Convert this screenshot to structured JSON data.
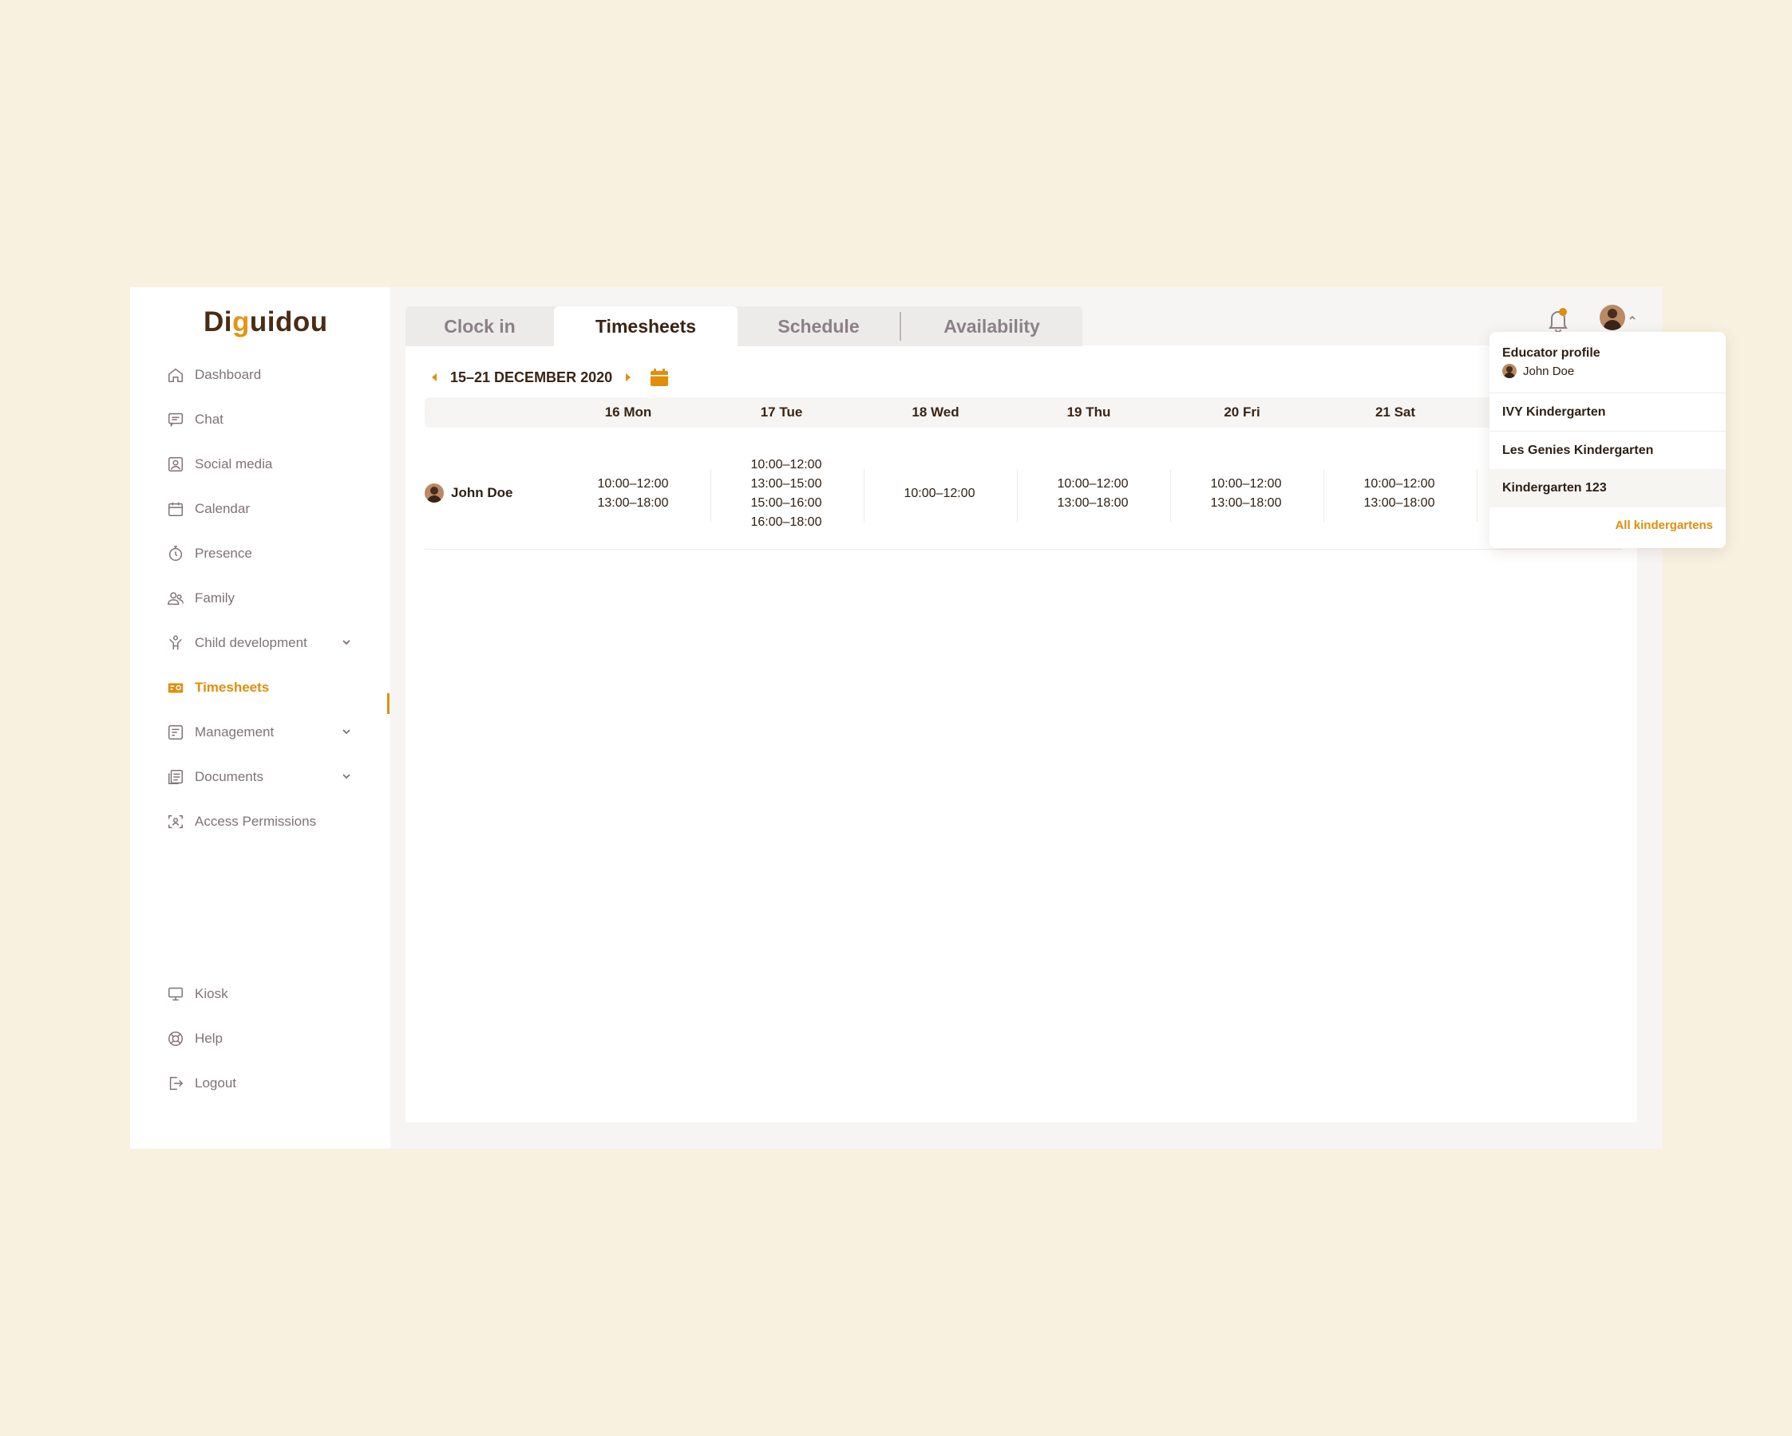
{
  "app": {
    "logo_prefix": "Di",
    "logo_accent": "g",
    "logo_suffix": "uidou"
  },
  "sidebar": {
    "items": [
      {
        "label": "Dashboard"
      },
      {
        "label": "Chat"
      },
      {
        "label": "Social media"
      },
      {
        "label": "Calendar"
      },
      {
        "label": "Presence"
      },
      {
        "label": "Family"
      },
      {
        "label": "Child development"
      },
      {
        "label": "Timesheets"
      },
      {
        "label": "Management"
      },
      {
        "label": "Documents"
      },
      {
        "label": "Access Permissions"
      }
    ],
    "bottom_items": [
      {
        "label": "Kiosk"
      },
      {
        "label": "Help"
      },
      {
        "label": "Logout"
      }
    ],
    "active_item": "Timesheets"
  },
  "tabs": [
    {
      "label": "Clock in"
    },
    {
      "label": "Timesheets"
    },
    {
      "label": "Schedule"
    },
    {
      "label": "Availability"
    }
  ],
  "week": {
    "label": "15–21 DECEMBER 2020"
  },
  "table": {
    "days": [
      "16 Mon",
      "17 Tue",
      "18 Wed",
      "19 Thu",
      "20 Fri",
      "21 Sat"
    ],
    "rows": [
      {
        "employee": "John Doe",
        "cells": [
          [
            "10:00–12:00",
            "13:00–18:00"
          ],
          [
            "10:00–12:00",
            "13:00–15:00",
            "15:00–16:00",
            "16:00–18:00"
          ],
          [
            "10:00–12:00"
          ],
          [
            "10:00–12:00",
            "13:00–18:00"
          ],
          [
            "10:00–12:00",
            "13:00–18:00"
          ],
          [
            "10:00–12:00",
            "13:00–18:00"
          ]
        ]
      }
    ]
  },
  "dropdown": {
    "profile_title": "Educator profile",
    "profile_name": "John Doe",
    "kindergartens": [
      "IVY Kindergarten",
      "Les Genies Kindergarten",
      "Kindergarten 123"
    ],
    "all_label": "All kindergartens"
  },
  "colors": {
    "accent": "#e08e0b",
    "page_bg": "#f8f1df",
    "text_dark": "#3a2414"
  }
}
